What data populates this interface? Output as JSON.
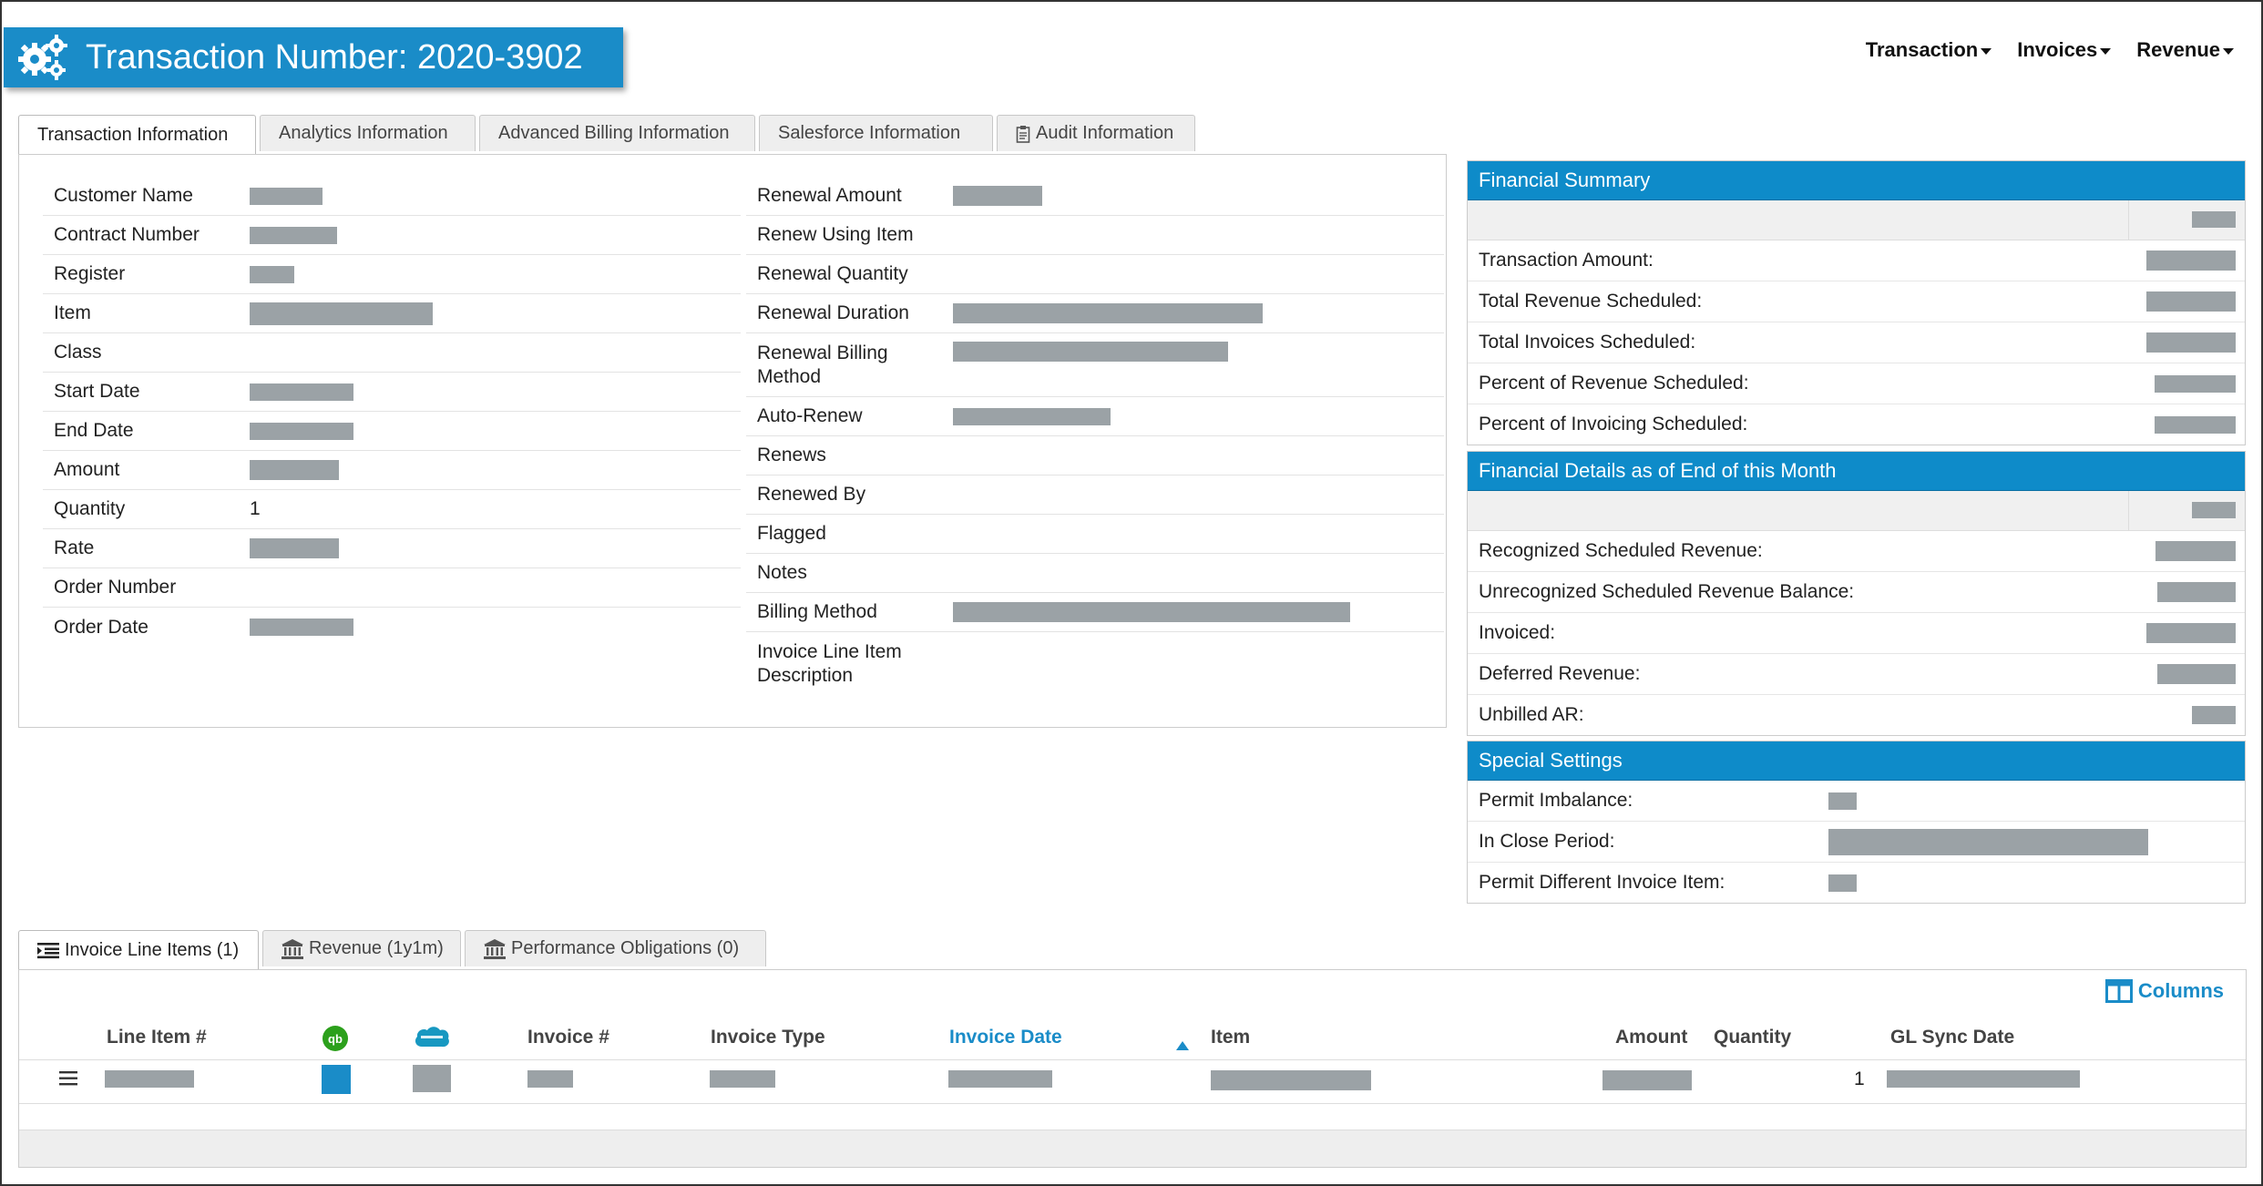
{
  "header": {
    "title": "Transaction Number: 2020-3902",
    "nav": [
      "Transaction",
      "Invoices",
      "Revenue"
    ]
  },
  "tabs": [
    {
      "label": "Transaction Information",
      "active": true
    },
    {
      "label": "Analytics Information",
      "active": false
    },
    {
      "label": "Advanced Billing Information",
      "active": false
    },
    {
      "label": "Salesforce Information",
      "active": false
    },
    {
      "label": "Audit Information",
      "active": false,
      "icon": "clipboard-icon"
    }
  ],
  "details_left": [
    {
      "label": "Customer Name",
      "value": ""
    },
    {
      "label": "Contract Number",
      "value": ""
    },
    {
      "label": "Register",
      "value": ""
    },
    {
      "label": "Item",
      "value": ""
    },
    {
      "label": "Class",
      "value": ""
    },
    {
      "label": "Start Date",
      "value": ""
    },
    {
      "label": "End Date",
      "value": ""
    },
    {
      "label": "Amount",
      "value": ""
    },
    {
      "label": "Quantity",
      "value": "1"
    },
    {
      "label": "Rate",
      "value": ""
    },
    {
      "label": "Order Number",
      "value": ""
    },
    {
      "label": "Order Date",
      "value": ""
    }
  ],
  "details_right": [
    {
      "label": "Renewal Amount",
      "value": ""
    },
    {
      "label": "Renew Using Item",
      "value": ""
    },
    {
      "label": "Renewal Quantity",
      "value": ""
    },
    {
      "label": "Renewal Duration",
      "value": ""
    },
    {
      "label": "Renewal Billing Method",
      "value": ""
    },
    {
      "label": "Auto-Renew",
      "value": ""
    },
    {
      "label": "Renews",
      "value": ""
    },
    {
      "label": "Renewed By",
      "value": ""
    },
    {
      "label": "Flagged",
      "value": ""
    },
    {
      "label": "Notes",
      "value": ""
    },
    {
      "label": "Billing Method",
      "value": ""
    },
    {
      "label": "Invoice Line Item Description",
      "value": ""
    }
  ],
  "financial_summary": {
    "title": "Financial Summary",
    "rows": [
      "Transaction Amount:",
      "Total Revenue Scheduled:",
      "Total Invoices Scheduled:",
      "Percent of Revenue Scheduled:",
      "Percent of Invoicing Scheduled:"
    ]
  },
  "financial_details": {
    "title": "Financial Details as of End of this Month",
    "rows": [
      "Recognized Scheduled Revenue:",
      "Unrecognized Scheduled Revenue Balance:",
      "Invoiced:",
      "Deferred Revenue:",
      "Unbilled AR:"
    ]
  },
  "special_settings": {
    "title": "Special Settings",
    "rows": [
      "Permit Imbalance:",
      "In Close Period:",
      "Permit Different Invoice Item:"
    ]
  },
  "bottom_tabs": [
    {
      "label": "Invoice Line Items (1)",
      "active": true,
      "icon": "list-icon"
    },
    {
      "label": "Revenue (1y1m)",
      "active": false,
      "icon": "bank-icon"
    },
    {
      "label": "Performance Obligations (0)",
      "active": false,
      "icon": "bank-icon"
    }
  ],
  "grid": {
    "columns_button": "Columns",
    "headers": [
      "Line Item #",
      "Invoice #",
      "Invoice Type",
      "Invoice Date",
      "Item",
      "Amount",
      "Quantity",
      "GL Sync Date"
    ],
    "sorted_column": "Invoice Date",
    "row": {
      "quantity": "1"
    }
  },
  "colors": {
    "accent": "#1a8cc8",
    "panel_header": "#0e8bc9",
    "redaction": "#9ba2a6",
    "quickbooks_green": "#2ca01c",
    "salesforce_blue": "#1798c1"
  }
}
